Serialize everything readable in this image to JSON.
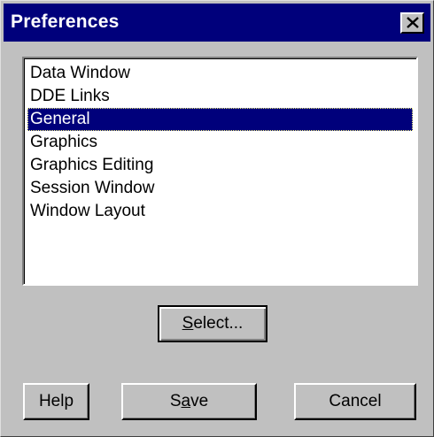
{
  "window": {
    "title": "Preferences",
    "close_icon": "close-icon"
  },
  "list": {
    "items": [
      "Data Window",
      "DDE Links",
      "General",
      "Graphics",
      "Graphics Editing",
      "Session Window",
      "Window Layout"
    ],
    "selected": "General"
  },
  "buttons": {
    "select": {
      "pre": "",
      "mnemonic": "S",
      "post": "elect..."
    },
    "help": {
      "label": "Help"
    },
    "save": {
      "pre": "S",
      "mnemonic": "a",
      "post": "ve"
    },
    "cancel": {
      "label": "Cancel"
    }
  },
  "colors": {
    "title_bar": "#00007b",
    "face": "#c0c0c0",
    "selection": "#00007b"
  }
}
